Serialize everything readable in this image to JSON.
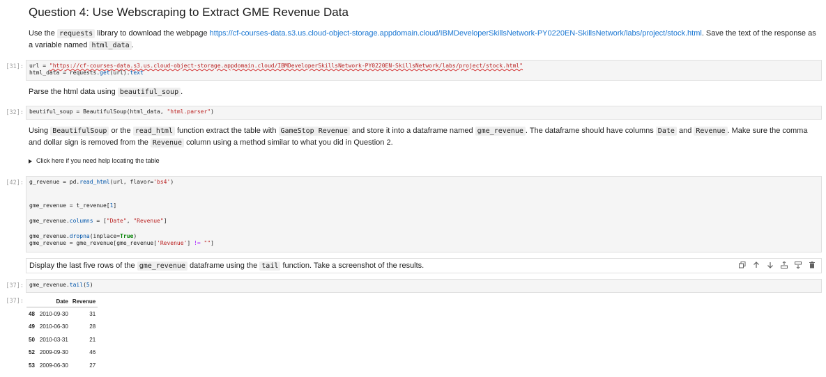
{
  "heading": "Question 4: Use Webscraping to Extract GME Revenue Data",
  "intro": {
    "p1": "Use the",
    "code1": "requests",
    "p2": "library to download the webpage",
    "link": "https://cf-courses-data.s3.us.cloud-object-storage.appdomain.cloud/IBMDeveloperSkillsNetwork-PY0220EN-SkillsNetwork/labs/project/stock.html",
    "p3": ". Save the text of the response as a variable named",
    "code2": "html_data",
    "p4": "."
  },
  "cells": {
    "c31": {
      "prompt": "[31]:"
    },
    "c32": {
      "prompt": "[32]:"
    },
    "c42": {
      "prompt": "[42]:"
    },
    "c37": {
      "prompt": "[37]:"
    },
    "out37": {
      "prompt": "[37]:"
    }
  },
  "parse_text": {
    "p1": "Parse the html data using",
    "code": "beautiful_soup",
    "p2": "."
  },
  "instructions": {
    "p1": "Using",
    "c1": "BeautifulSoup",
    "p2": "or the",
    "c2": "read_html",
    "p3": "function extract the table with",
    "c3": "GameStop Revenue",
    "p4": "and store it into a dataframe named",
    "c4": "gme_revenue",
    "p5": ". The dataframe should have columns",
    "c5": "Date",
    "p6": "and",
    "c6": "Revenue",
    "p7": ". Make sure the comma and dollar sign is removed from the",
    "c7": "Revenue",
    "p8": "column using a method similar to what you did in Question 2."
  },
  "details_summary": "Click here if you need help locating the table",
  "display_text": {
    "p1": "Display the last five rows of the",
    "c1": "gme_revenue",
    "p2": "dataframe using the",
    "c2": "tail",
    "p3": "function. Take a screenshot of the results."
  },
  "toolbar_icons": [
    "duplicate-icon",
    "move-up-icon",
    "move-down-icon",
    "insert-above-icon",
    "insert-below-icon",
    "delete-icon"
  ],
  "dataframe": {
    "columns": [
      "",
      "Date",
      "Revenue"
    ],
    "rows": [
      {
        "index": "48",
        "date": "2010-09-30",
        "revenue": "31"
      },
      {
        "index": "49",
        "date": "2010-06-30",
        "revenue": "28"
      },
      {
        "index": "50",
        "date": "2010-03-31",
        "revenue": "21"
      },
      {
        "index": "52",
        "date": "2009-09-30",
        "revenue": "46"
      },
      {
        "index": "53",
        "date": "2009-06-30",
        "revenue": "27"
      }
    ]
  }
}
